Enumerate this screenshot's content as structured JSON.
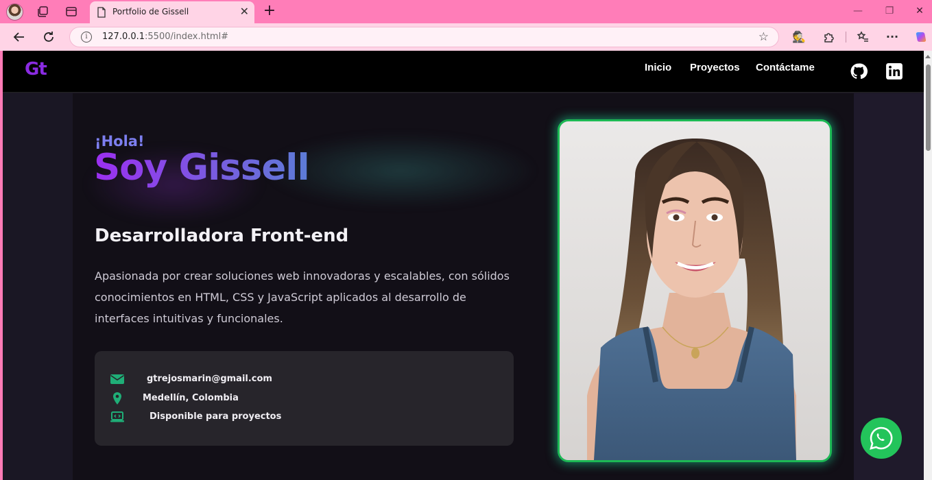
{
  "browser": {
    "tab": {
      "title": "Portfolio de Gissell"
    },
    "url": {
      "host": "127.0.0.1",
      "rest": ":5500/index.html#"
    }
  },
  "site": {
    "logo": "Gt",
    "nav": {
      "inicio": "Inicio",
      "proyectos": "Proyectos",
      "contacto": "Contáctame"
    },
    "hero": {
      "greeting": "¡Hola!",
      "name": "Soy Gissell",
      "role": "Desarrolladora Front-end",
      "description": "Apasionada por crear soluciones web innovadoras y escalables, con sólidos conocimientos en HTML, CSS y JavaScript aplicados al desarrollo de interfaces intuitivas y funcionales."
    },
    "contact": {
      "email": "gtrejosmarin@gmail.com",
      "location": "Medellín, Colombia",
      "availability": "Disponible para proyectos"
    },
    "colors": {
      "accent": "#8a2be2",
      "green": "#1db954",
      "whatsapp": "#23c45b"
    }
  }
}
